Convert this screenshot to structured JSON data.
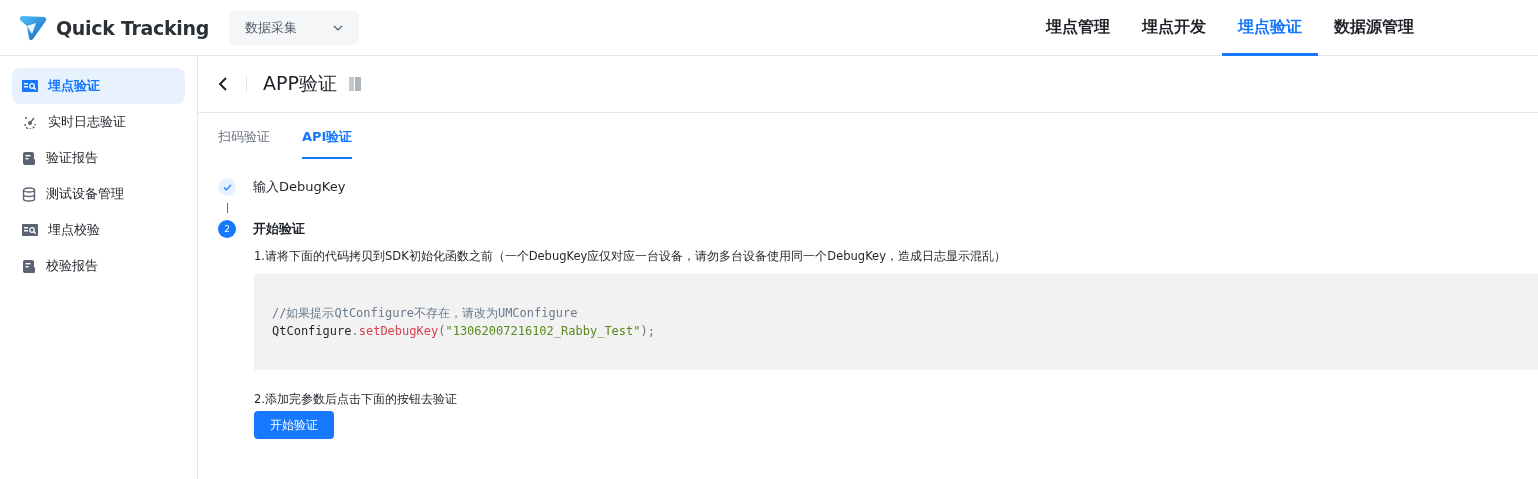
{
  "header": {
    "logo": "Quick Tracking",
    "project_select": "数据采集",
    "nav": [
      {
        "label": "埋点管理",
        "selected": false
      },
      {
        "label": "埋点开发",
        "selected": false
      },
      {
        "label": "埋点验证",
        "selected": true
      },
      {
        "label": "数据源管理",
        "selected": false
      }
    ]
  },
  "sidebar": {
    "items": [
      {
        "label": "埋点验证",
        "kind": "card",
        "selected": true
      },
      {
        "label": "实时日志验证",
        "kind": "gauge",
        "selected": false
      },
      {
        "label": "验证报告",
        "kind": "report",
        "selected": false
      },
      {
        "label": "测试设备管理",
        "kind": "database",
        "selected": false
      },
      {
        "label": "埋点校验",
        "kind": "card",
        "selected": false
      },
      {
        "label": "校验报告",
        "kind": "report",
        "selected": false
      }
    ]
  },
  "page": {
    "title": "APP验证",
    "tabs": [
      {
        "label": "扫码验证",
        "selected": false
      },
      {
        "label": "API验证",
        "selected": true
      }
    ],
    "steps": [
      {
        "label": "输入DebugKey",
        "completed": true
      },
      {
        "label": "开始验证",
        "completed": false,
        "number": "2"
      }
    ],
    "instruction_1": "1.请将下面的代码拷贝到SDK初始化函数之前（一个DebugKey应仅对应一台设备，请勿多台设备使用同一个DebugKey，造成日志显示混乱）",
    "code": {
      "comment": "//如果提示QtConfigure不存在，请改为UMConfigure",
      "tokens": [
        {
          "kind": "plain",
          "text": "QtConfigure"
        },
        {
          "kind": "punct",
          "text": "."
        },
        {
          "kind": "method",
          "text": "setDebugKey"
        },
        {
          "kind": "punct",
          "text": "("
        },
        {
          "kind": "string",
          "text": "\"13062007216102_Rabby_Test\""
        },
        {
          "kind": "punct",
          "text": ");"
        }
      ]
    },
    "instruction_2": "2.添加完参数后点击下面的按钮去验证",
    "button": "开始验证"
  }
}
